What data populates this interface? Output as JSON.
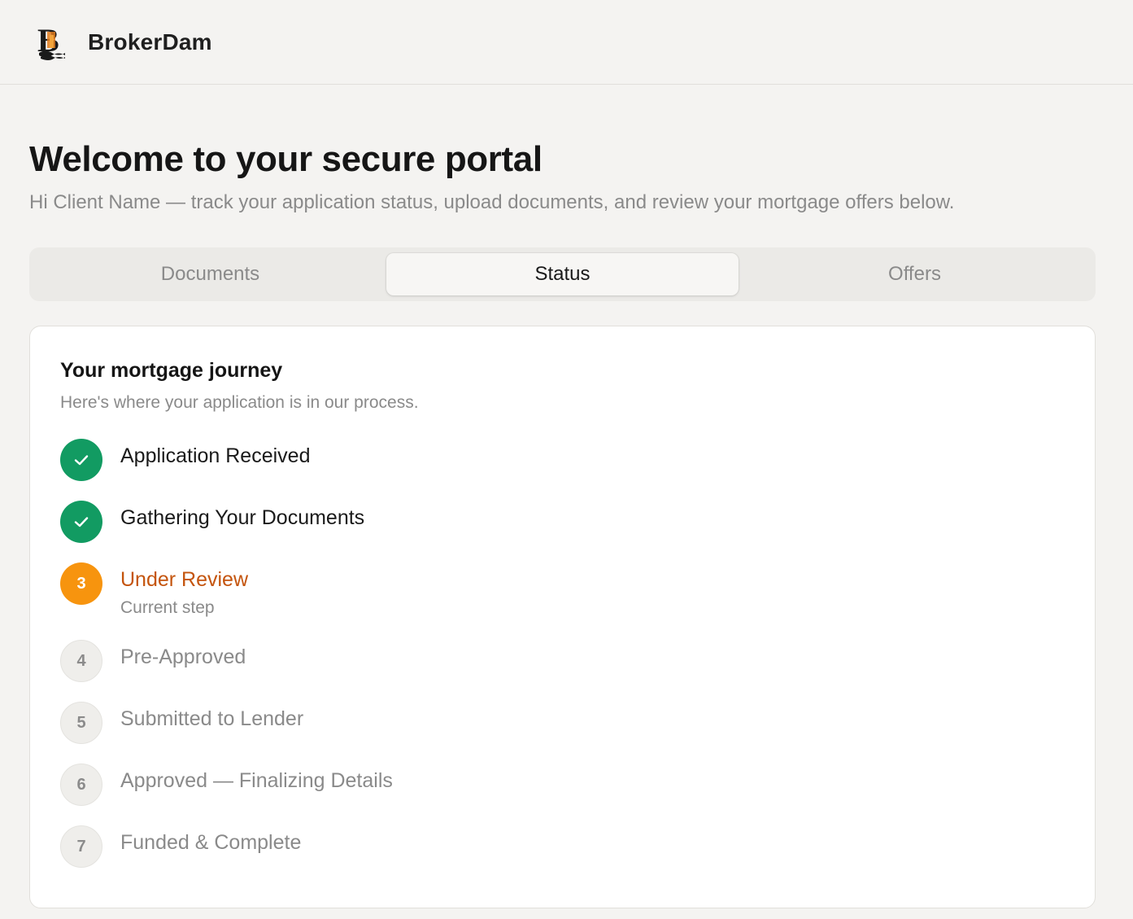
{
  "header": {
    "brand": "BrokerDam",
    "logo_icon": "brokerdam-logo-icon"
  },
  "hero": {
    "title": "Welcome to your secure portal",
    "subtitle": "Hi Client Name — track your application status, upload documents, and review your mortgage offers below."
  },
  "tabs": [
    {
      "label": "Documents",
      "active": false
    },
    {
      "label": "Status",
      "active": true
    },
    {
      "label": "Offers",
      "active": false
    }
  ],
  "journey": {
    "title": "Your mortgage journey",
    "subtitle": "Here's where your application is in our process.",
    "steps": [
      {
        "number": "1",
        "label": "Application Received",
        "state": "done",
        "icon": "check-icon"
      },
      {
        "number": "2",
        "label": "Gathering Your Documents",
        "state": "done",
        "icon": "check-icon"
      },
      {
        "number": "3",
        "label": "Under Review",
        "state": "current",
        "note": "Current step"
      },
      {
        "number": "4",
        "label": "Pre-Approved",
        "state": "pending"
      },
      {
        "number": "5",
        "label": "Submitted to Lender",
        "state": "pending"
      },
      {
        "number": "6",
        "label": "Approved — Finalizing Details",
        "state": "pending"
      },
      {
        "number": "7",
        "label": "Funded & Complete",
        "state": "pending"
      }
    ]
  },
  "colors": {
    "done": "#129b62",
    "current": "#f7940e",
    "current_text": "#c4540d",
    "pending": "#efeeeb",
    "background": "#f4f3f1"
  }
}
